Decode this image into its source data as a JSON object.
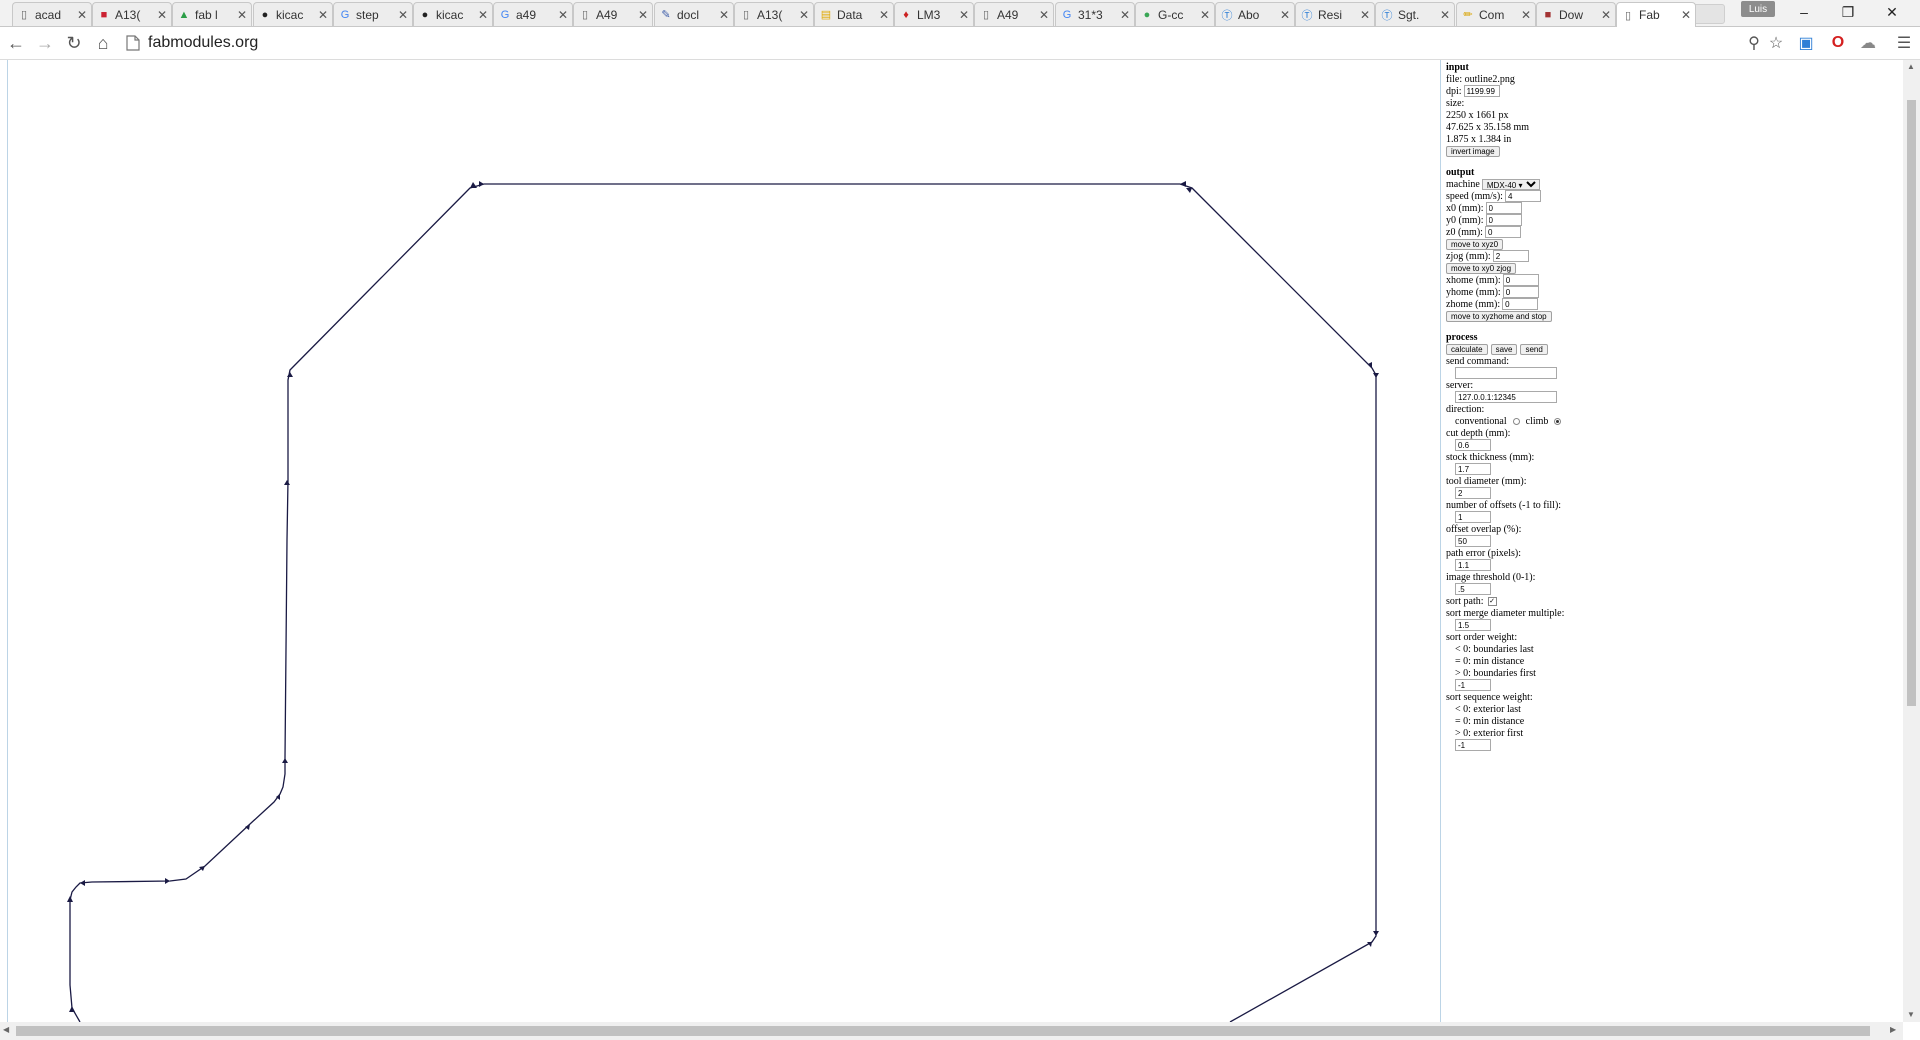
{
  "tabs": [
    {
      "label": "acad",
      "icon": "document-icon",
      "color": "#666666"
    },
    {
      "label": "A13(",
      "icon": "site-logo-icon",
      "color": "#cc2233"
    },
    {
      "label": "fab l",
      "icon": "drive-icon",
      "color": "#2a9d46"
    },
    {
      "label": "kicac",
      "icon": "github-icon",
      "color": "#222222"
    },
    {
      "label": "step",
      "icon": "google-icon",
      "color": "#4285f4"
    },
    {
      "label": "kicac",
      "icon": "github-icon",
      "color": "#222222"
    },
    {
      "label": "a49",
      "icon": "google-icon",
      "color": "#4285f4"
    },
    {
      "label": "A49",
      "icon": "document-icon",
      "color": "#666666"
    },
    {
      "label": "docl",
      "icon": "pen-icon",
      "color": "#3b5ba8"
    },
    {
      "label": "A13(",
      "icon": "document-icon",
      "color": "#666666"
    },
    {
      "label": "Data",
      "icon": "datasheet-icon",
      "color": "#e0a800"
    },
    {
      "label": "LM3",
      "icon": "ti-logo-icon",
      "color": "#cc2222"
    },
    {
      "label": "A49",
      "icon": "document-icon",
      "color": "#666666"
    },
    {
      "label": "31*3",
      "icon": "google-icon",
      "color": "#4285f4"
    },
    {
      "label": "G-cc",
      "icon": "leaf-icon",
      "color": "#3aa655"
    },
    {
      "label": "Abo",
      "icon": "t-logo-icon",
      "color": "#2f7fd6"
    },
    {
      "label": "Resi",
      "icon": "t-logo-icon",
      "color": "#2f7fd6"
    },
    {
      "label": "Sgt.",
      "icon": "t-logo-icon",
      "color": "#2f7fd6"
    },
    {
      "label": "Com",
      "icon": "pencil-icon",
      "color": "#d9a300"
    },
    {
      "label": "Dow",
      "icon": "download-site-icon",
      "color": "#a33333"
    },
    {
      "label": "Fab",
      "icon": "document-icon",
      "color": "#666666",
      "active": true
    }
  ],
  "window": {
    "profile": "Luis"
  },
  "address": {
    "url": "fabmodules.org"
  },
  "panel": {
    "input": {
      "heading": "input",
      "file": "file: outline2.png",
      "dpi_label": "dpi:",
      "dpi_value": "1199.99",
      "size_label": "size:",
      "size_px": "2250 x 1661 px",
      "size_mm": "47.625 x 35.158 mm",
      "size_in": "1.875 x 1.384 in",
      "invert_button": "invert image"
    },
    "output": {
      "heading": "output",
      "machine_label": "machine",
      "machine_value": "MDX-40 ▾",
      "speed_label": "speed (mm/s):",
      "speed_value": "4",
      "x0_label": "x0 (mm):",
      "x0_value": "0",
      "y0_label": "y0 (mm):",
      "y0_value": "0",
      "z0_label": "z0 (mm):",
      "z0_value": "0",
      "move_xyz0": "move to xyz0",
      "zjog_label": "zjog (mm):",
      "zjog_value": "2",
      "move_xy0_zjog": "move to xy0 zjog",
      "xhome_label": "xhome (mm):",
      "xhome_value": "0",
      "yhome_label": "yhome (mm):",
      "yhome_value": "0",
      "zhome_label": "zhome (mm):",
      "zhome_value": "0",
      "move_home_stop": "move to xyzhome and stop"
    },
    "process": {
      "heading": "process",
      "calculate": "calculate",
      "save": "save",
      "send": "send",
      "send_command_label": "send command:",
      "send_command_value": "",
      "server_label": "server:",
      "server_value": "127.0.0.1:12345",
      "direction_label": "direction:",
      "conventional_label": "conventional",
      "climb_label": "climb",
      "cut_depth_label": "cut depth (mm):",
      "cut_depth_value": "0.6",
      "stock_label": "stock thickness (mm):",
      "stock_value": "1.7",
      "tool_label": "tool diameter (mm):",
      "tool_value": "2",
      "offsets_label": "number of offsets (-1 to fill):",
      "offsets_value": "1",
      "overlap_label": "offset overlap (%):",
      "overlap_value": "50",
      "path_error_label": "path error (pixels):",
      "path_error_value": "1.1",
      "threshold_label": "image threshold (0-1):",
      "threshold_value": ".5",
      "sort_path_label": "sort path:",
      "sort_merge_label": "sort merge diameter multiple:",
      "sort_merge_value": "1.5",
      "sort_order_label": "sort order weight:",
      "sort_order_lt": "< 0: boundaries last",
      "sort_order_eq": "= 0: min distance",
      "sort_order_gt": "> 0: boundaries first",
      "sort_order_value": "-1",
      "sort_seq_label": "sort sequence weight:",
      "sort_seq_lt": "< 0: exterior last",
      "sort_seq_eq": "= 0: min distance",
      "sort_seq_gt": "> 0: exterior first",
      "sort_seq_value": "-1"
    }
  },
  "colors": {
    "toolpath": "#1a1a44",
    "divider": "#bcd4e6"
  }
}
